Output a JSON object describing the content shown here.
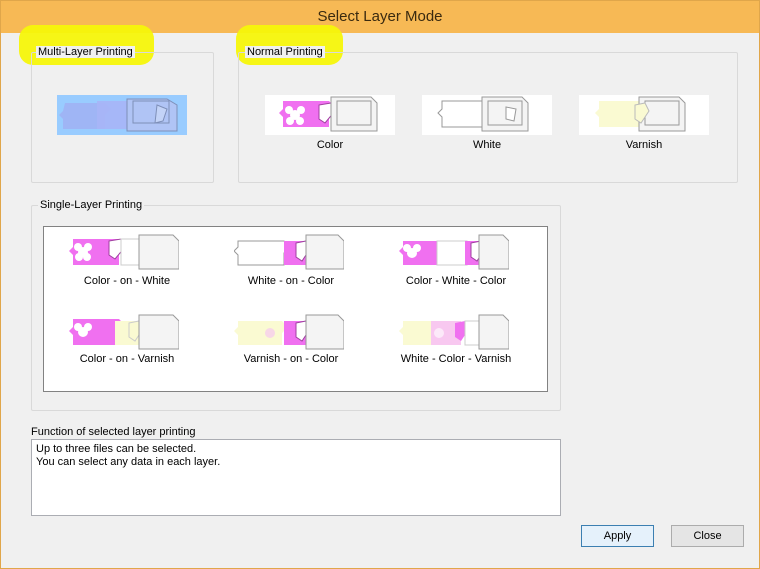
{
  "window": {
    "title": "Select Layer Mode"
  },
  "groups": {
    "multi_layer": {
      "label": "Multi-Layer Printing"
    },
    "normal": {
      "label": "Normal Printing",
      "items": [
        {
          "label": "Color",
          "icon": "color-layer-icon"
        },
        {
          "label": "White",
          "icon": "white-layer-icon"
        },
        {
          "label": "Varnish",
          "icon": "varnish-layer-icon"
        }
      ]
    },
    "single_layer": {
      "label": "Single-Layer Printing",
      "items": [
        {
          "label": "Color - on - White",
          "icon": "color-on-white-icon"
        },
        {
          "label": "White - on - Color",
          "icon": "white-on-color-icon"
        },
        {
          "label": "Color - White - Color",
          "icon": "color-white-color-icon"
        },
        {
          "label": "Color - on - Varnish",
          "icon": "color-on-varnish-icon"
        },
        {
          "label": "Varnish - on - Color",
          "icon": "varnish-on-color-icon"
        },
        {
          "label": "White - Color - Varnish",
          "icon": "white-color-varnish-icon"
        }
      ]
    }
  },
  "function": {
    "label": "Function of selected layer printing",
    "text_line1": "Up to three files can be selected.",
    "text_line2": "You can select any data in each layer."
  },
  "buttons": {
    "apply": "Apply",
    "close": "Close"
  },
  "colors": {
    "title_bar": "#f7b955",
    "magenta": "#f070f0",
    "varnish": "#fafad2",
    "selection": "#99ccff",
    "highlight": "#f5f50a"
  }
}
